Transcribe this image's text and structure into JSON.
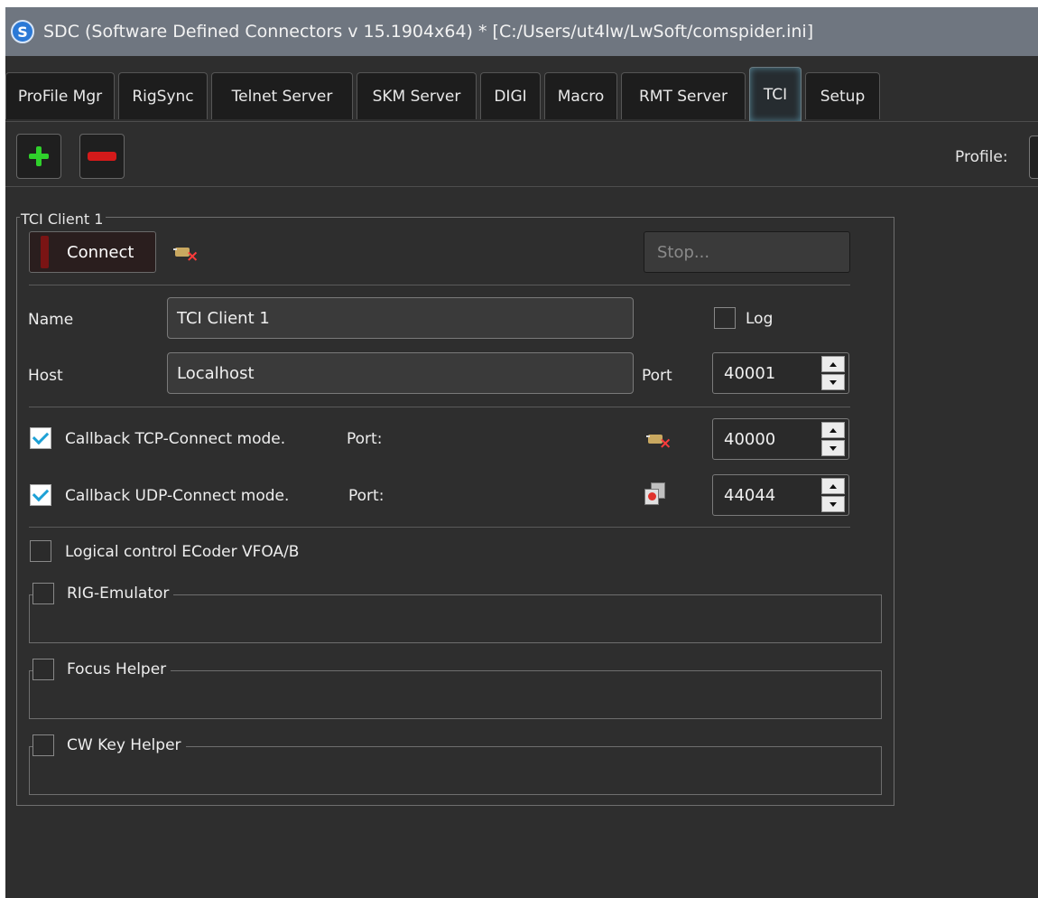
{
  "window": {
    "title": "SDC (Software Defined Connectors v 15.1904x64) * [C:/Users/ut4lw/LwSoft/comspider.ini]",
    "app_icon_glyph": "S",
    "app_icon": "sdc-app-icon"
  },
  "tabs": [
    {
      "label": "ProFile Mgr",
      "active": false
    },
    {
      "label": "RigSync",
      "active": false
    },
    {
      "label": "Telnet Server",
      "active": false
    },
    {
      "label": "SKM Server",
      "active": false
    },
    {
      "label": "DIGI",
      "active": false
    },
    {
      "label": "Macro",
      "active": false
    },
    {
      "label": "RMT Server",
      "active": false
    },
    {
      "label": "TCI",
      "active": true
    },
    {
      "label": "Setup",
      "active": false
    }
  ],
  "toolbar": {
    "add_icon": "plus-icon",
    "remove_icon": "minus-icon",
    "profile_label": "Profile:"
  },
  "client": {
    "group_title": "TCI Client 1",
    "connect_label": "Connect",
    "status_icon": "plug-disconnected-icon",
    "stop_label": "Stop...",
    "name_label": "Name",
    "name_value": "TCI Client 1",
    "log_label": "Log",
    "log_checked": false,
    "host_label": "Host",
    "host_value": "Localhost",
    "port_label": "Port",
    "port_value": "40001",
    "callback_tcp": {
      "label": "Callback TCP-Connect mode.",
      "checked": true,
      "port_label": "Port:",
      "icon": "plug-disconnected-icon",
      "port_value": "40000"
    },
    "callback_udp": {
      "label": "Callback UDP-Connect mode.",
      "checked": true,
      "port_label": "Port:",
      "icon": "network-card-icon",
      "port_value": "44044"
    },
    "logical_control": {
      "label": "Logical control ECoder VFOA/B",
      "checked": false
    },
    "rig_emulator": {
      "label": "RIG-Emulator",
      "checked": false
    },
    "focus_helper": {
      "label": "Focus Helper",
      "checked": false
    },
    "cw_key_helper": {
      "label": "CW Key Helper",
      "checked": false
    }
  },
  "colors": {
    "window_bg": "#2e2e2e",
    "titlebar_bg": "#6f7680",
    "add_green": "#2fd12b",
    "remove_red": "#d41a1a",
    "check_blue": "#1da1d6"
  }
}
